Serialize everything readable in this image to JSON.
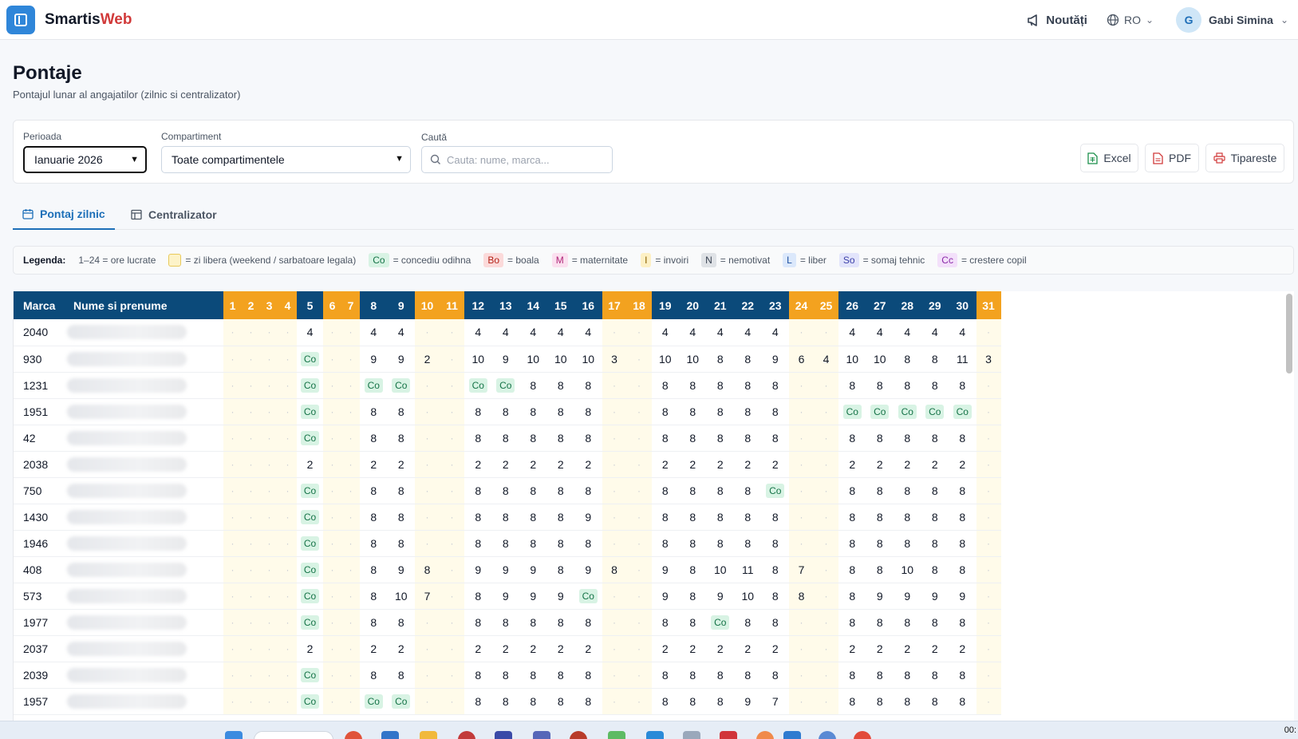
{
  "app": {
    "brand_main": "Smartis",
    "brand_accent": "Web"
  },
  "topbar": {
    "news_label": "Noutăți",
    "lang_label": "RO",
    "user_initial": "G",
    "user_name": "Gabi Simina"
  },
  "page": {
    "title": "Pontaje",
    "subtitle": "Pontajul lunar al angajatilor (zilnic si centralizator)"
  },
  "filters": {
    "period_label": "Perioada",
    "period_value": "Ianuarie 2026",
    "dept_label": "Compartiment",
    "dept_value": "Toate compartimentele",
    "search_label": "Caută",
    "search_placeholder": "Cauta: nume, marca..."
  },
  "actions": {
    "excel": "Excel",
    "pdf": "PDF",
    "print": "Tipareste"
  },
  "tabs": {
    "daily": "Pontaj zilnic",
    "summary": "Centralizator"
  },
  "legend": {
    "title": "Legenda:",
    "hours": "1–24 = ore lucrate",
    "free": "= zi libera (weekend / sarbatoare legala)",
    "items": [
      {
        "code": "Co",
        "text": "= concediu odihna",
        "bg": "#d8f3e4",
        "fg": "#157347"
      },
      {
        "code": "Bo",
        "text": "= boala",
        "bg": "#fbdada",
        "fg": "#b42318"
      },
      {
        "code": "M",
        "text": "= maternitate",
        "bg": "#fbe0ef",
        "fg": "#b0277a"
      },
      {
        "code": "I",
        "text": "= invoiri",
        "bg": "#fdf0c4",
        "fg": "#8a6100"
      },
      {
        "code": "N",
        "text": "= nemotivat",
        "bg": "#dfe2e6",
        "fg": "#374151"
      },
      {
        "code": "L",
        "text": "= liber",
        "bg": "#dbe8fb",
        "fg": "#1d4fa0"
      },
      {
        "code": "So",
        "text": "= somaj tehnic",
        "bg": "#e2e4fb",
        "fg": "#3b3fa8"
      },
      {
        "code": "Cc",
        "text": "= crestere copil",
        "bg": "#f3e0fa",
        "fg": "#8a2aa8"
      }
    ]
  },
  "table": {
    "col_marca": "Marca",
    "col_name": "Nume si prenume",
    "free_days": [
      1,
      2,
      3,
      4,
      6,
      7,
      10,
      11,
      17,
      18,
      24,
      25,
      31
    ],
    "rows": [
      {
        "marca": "2040",
        "d": [
          "·",
          "·",
          "·",
          "·",
          "4",
          "·",
          "·",
          "4",
          "4",
          "·",
          "·",
          "4",
          "4",
          "4",
          "4",
          "4",
          "·",
          "·",
          "4",
          "4",
          "4",
          "4",
          "4",
          "·",
          "·",
          "4",
          "4",
          "4",
          "4",
          "4",
          "·"
        ]
      },
      {
        "marca": "930",
        "d": [
          "·",
          "·",
          "·",
          "·",
          "Co",
          "·",
          "·",
          "9",
          "9",
          "2",
          "·",
          "10",
          "9",
          "10",
          "10",
          "10",
          "3",
          "·",
          "10",
          "10",
          "8",
          "8",
          "9",
          "6",
          "4",
          "10",
          "10",
          "8",
          "8",
          "11",
          "3"
        ]
      },
      {
        "marca": "1231",
        "d": [
          "·",
          "·",
          "·",
          "·",
          "Co",
          "·",
          "·",
          "Co",
          "Co",
          "·",
          "·",
          "Co",
          "Co",
          "8",
          "8",
          "8",
          "·",
          "·",
          "8",
          "8",
          "8",
          "8",
          "8",
          "·",
          "·",
          "8",
          "8",
          "8",
          "8",
          "8",
          "·"
        ]
      },
      {
        "marca": "1951",
        "d": [
          "·",
          "·",
          "·",
          "·",
          "Co",
          "·",
          "·",
          "8",
          "8",
          "·",
          "·",
          "8",
          "8",
          "8",
          "8",
          "8",
          "·",
          "·",
          "8",
          "8",
          "8",
          "8",
          "8",
          "·",
          "·",
          "Co",
          "Co",
          "Co",
          "Co",
          "Co",
          "·"
        ]
      },
      {
        "marca": "42",
        "d": [
          "·",
          "·",
          "·",
          "·",
          "Co",
          "·",
          "·",
          "8",
          "8",
          "·",
          "·",
          "8",
          "8",
          "8",
          "8",
          "8",
          "·",
          "·",
          "8",
          "8",
          "8",
          "8",
          "8",
          "·",
          "·",
          "8",
          "8",
          "8",
          "8",
          "8",
          "·"
        ]
      },
      {
        "marca": "2038",
        "d": [
          "·",
          "·",
          "·",
          "·",
          "2",
          "·",
          "·",
          "2",
          "2",
          "·",
          "·",
          "2",
          "2",
          "2",
          "2",
          "2",
          "·",
          "·",
          "2",
          "2",
          "2",
          "2",
          "2",
          "·",
          "·",
          "2",
          "2",
          "2",
          "2",
          "2",
          "·"
        ]
      },
      {
        "marca": "750",
        "d": [
          "·",
          "·",
          "·",
          "·",
          "Co",
          "·",
          "·",
          "8",
          "8",
          "·",
          "·",
          "8",
          "8",
          "8",
          "8",
          "8",
          "·",
          "·",
          "8",
          "8",
          "8",
          "8",
          "Co",
          "·",
          "·",
          "8",
          "8",
          "8",
          "8",
          "8",
          "·"
        ]
      },
      {
        "marca": "1430",
        "d": [
          "·",
          "·",
          "·",
          "·",
          "Co",
          "·",
          "·",
          "8",
          "8",
          "·",
          "·",
          "8",
          "8",
          "8",
          "8",
          "9",
          "·",
          "·",
          "8",
          "8",
          "8",
          "8",
          "8",
          "·",
          "·",
          "8",
          "8",
          "8",
          "8",
          "8",
          "·"
        ]
      },
      {
        "marca": "1946",
        "d": [
          "·",
          "·",
          "·",
          "·",
          "Co",
          "·",
          "·",
          "8",
          "8",
          "·",
          "·",
          "8",
          "8",
          "8",
          "8",
          "8",
          "·",
          "·",
          "8",
          "8",
          "8",
          "8",
          "8",
          "·",
          "·",
          "8",
          "8",
          "8",
          "8",
          "8",
          "·"
        ]
      },
      {
        "marca": "408",
        "d": [
          "·",
          "·",
          "·",
          "·",
          "Co",
          "·",
          "·",
          "8",
          "9",
          "8",
          "·",
          "9",
          "9",
          "9",
          "8",
          "9",
          "8",
          "·",
          "9",
          "8",
          "10",
          "11",
          "8",
          "7",
          "·",
          "8",
          "8",
          "10",
          "8",
          "8",
          "·"
        ]
      },
      {
        "marca": "573",
        "d": [
          "·",
          "·",
          "·",
          "·",
          "Co",
          "·",
          "·",
          "8",
          "10",
          "7",
          "·",
          "8",
          "9",
          "9",
          "9",
          "Co",
          "·",
          "·",
          "9",
          "8",
          "9",
          "10",
          "8",
          "8",
          "·",
          "8",
          "9",
          "9",
          "9",
          "9",
          "·"
        ]
      },
      {
        "marca": "1977",
        "d": [
          "·",
          "·",
          "·",
          "·",
          "Co",
          "·",
          "·",
          "8",
          "8",
          "·",
          "·",
          "8",
          "8",
          "8",
          "8",
          "8",
          "·",
          "·",
          "8",
          "8",
          "Co",
          "8",
          "8",
          "·",
          "·",
          "8",
          "8",
          "8",
          "8",
          "8",
          "·"
        ]
      },
      {
        "marca": "2037",
        "d": [
          "·",
          "·",
          "·",
          "·",
          "2",
          "·",
          "·",
          "2",
          "2",
          "·",
          "·",
          "2",
          "2",
          "2",
          "2",
          "2",
          "·",
          "·",
          "2",
          "2",
          "2",
          "2",
          "2",
          "·",
          "·",
          "2",
          "2",
          "2",
          "2",
          "2",
          "·"
        ]
      },
      {
        "marca": "2039",
        "d": [
          "·",
          "·",
          "·",
          "·",
          "Co",
          "·",
          "·",
          "8",
          "8",
          "·",
          "·",
          "8",
          "8",
          "8",
          "8",
          "8",
          "·",
          "·",
          "8",
          "8",
          "8",
          "8",
          "8",
          "·",
          "·",
          "8",
          "8",
          "8",
          "8",
          "8",
          "·"
        ]
      },
      {
        "marca": "1957",
        "d": [
          "·",
          "·",
          "·",
          "·",
          "Co",
          "·",
          "·",
          "Co",
          "Co",
          "·",
          "·",
          "8",
          "8",
          "8",
          "8",
          "8",
          "·",
          "·",
          "8",
          "8",
          "8",
          "9",
          "7",
          "·",
          "·",
          "8",
          "8",
          "8",
          "8",
          "8",
          "·"
        ]
      }
    ]
  },
  "taskbar": {
    "time": "00:"
  }
}
